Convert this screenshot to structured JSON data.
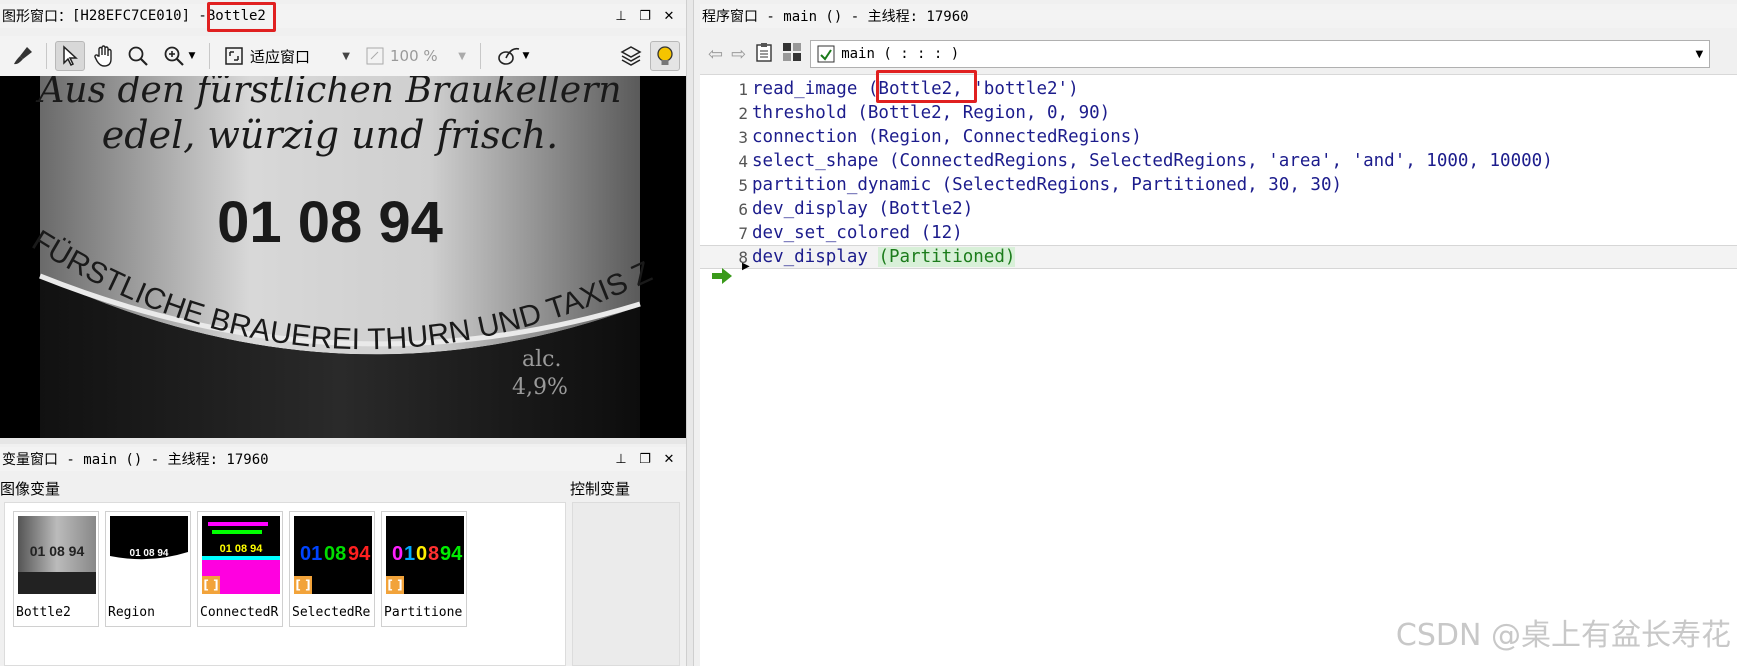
{
  "graphics_window": {
    "title": "图形窗口：[H28EFC7CE010] - Bottle2",
    "title_prefix": "图形窗口：",
    "title_id": "[H28EFC7CE010] - ",
    "title_image": "Bottle2",
    "toolbar": {
      "fit_label": "适应窗口",
      "zoom_value": "100 %"
    },
    "image_text": {
      "line1": "Aus den fürstlichen Braukellern",
      "line2": "edel, würzig und frisch.",
      "number": "01 08 94",
      "arc_text": "FÜRSTLICHE BRAUEREI THURN UND TAXIS ZU REGENSBURG",
      "alc": "alc.",
      "percent": "4,9%"
    }
  },
  "variable_window": {
    "title": "变量窗口 - main () - 主线程: 17960",
    "image_vars_label": "图像变量",
    "control_vars_label": "控制变量",
    "thumbnails": [
      {
        "name": "Bottle2"
      },
      {
        "name": "Region"
      },
      {
        "name": "ConnectedR"
      },
      {
        "name": "SelectedRe"
      },
      {
        "name": "Partitione"
      }
    ]
  },
  "program_window": {
    "title": "程序窗口 - main () - 主线程: 17960",
    "procedure": "main ( : : : )",
    "code": [
      {
        "n": "1",
        "text": "read_image (Bottle2, 'bottle2')"
      },
      {
        "n": "2",
        "text": "threshold (Bottle2, Region, 0, 90)"
      },
      {
        "n": "3",
        "text": "connection (Region, ConnectedRegions)"
      },
      {
        "n": "4",
        "text": "select_shape (ConnectedRegions, SelectedRegions, 'area', 'and', 1000, 10000)"
      },
      {
        "n": "5",
        "text": "partition_dynamic (SelectedRegions, Partitioned, 30, 30)"
      },
      {
        "n": "6",
        "text": "dev_display (Bottle2)"
      },
      {
        "n": "7",
        "text": "dev_set_colored (12)"
      },
      {
        "n": "8",
        "text_prefix": "dev_display ",
        "text_paren": "(Partitioned)"
      }
    ]
  },
  "watermark": "CSDN @桌上有盆长寿花",
  "colors": {
    "highlight_box": "#e02020",
    "code_text": "#1c1c8c",
    "pc_arrow": "#3a9a1a"
  }
}
